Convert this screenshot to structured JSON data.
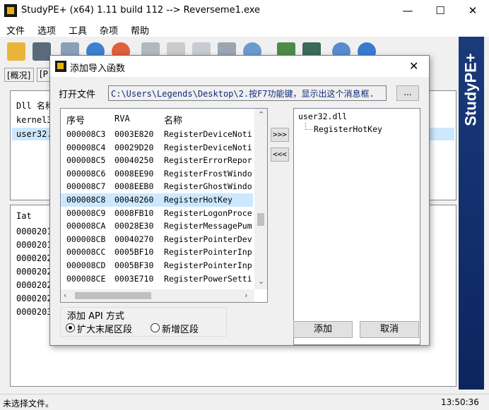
{
  "window": {
    "title": "StudyPE+ (x64) 1.11 build 112  --> Reverseme1.exe",
    "minimize": "—",
    "maximize": "☐",
    "close": "✕"
  },
  "menu": [
    "文件",
    "选项",
    "工具",
    "杂项",
    "帮助"
  ],
  "side_banner": "StudyPE+",
  "main_tabs": [
    "[概况]",
    "[P"
  ],
  "bg_upper": {
    "header": "Dll 名称",
    "rows": [
      "kernel3",
      "user32."
    ]
  },
  "bg_lower": {
    "header": "Iat",
    "rows": [
      "0000201",
      "0000201",
      "0000202",
      "0000202",
      "0000202",
      "0000202",
      "0000203"
    ]
  },
  "statusbar": {
    "left": "未选择文件。",
    "right": "13:50:36"
  },
  "dialog": {
    "title": "添加导入函数",
    "close": "✕",
    "file_label": "打开文件",
    "file_path": "C:\\Users\\Legends\\Desktop\\2.按F7功能键，显示出这个消息框.",
    "browse": "...",
    "columns": [
      "序号",
      "RVA",
      "名称"
    ],
    "rows": [
      {
        "ord": "000008C3",
        "rva": "0003E820",
        "name": "RegisterDeviceNoti"
      },
      {
        "ord": "000008C4",
        "rva": "00029D20",
        "name": "RegisterDeviceNoti"
      },
      {
        "ord": "000008C5",
        "rva": "00040250",
        "name": "RegisterErrorRepor"
      },
      {
        "ord": "000008C6",
        "rva": "0008EE90",
        "name": "RegisterFrostWindo"
      },
      {
        "ord": "000008C7",
        "rva": "0008EEB0",
        "name": "RegisterGhostWindo"
      },
      {
        "ord": "000008C8",
        "rva": "00040260",
        "name": "RegisterHotKey"
      },
      {
        "ord": "000008C9",
        "rva": "0008FB10",
        "name": "RegisterLogonProce"
      },
      {
        "ord": "000008CA",
        "rva": "00028E30",
        "name": "RegisterMessagePum"
      },
      {
        "ord": "000008CB",
        "rva": "00040270",
        "name": "RegisterPointerDev"
      },
      {
        "ord": "000008CC",
        "rva": "0005BF10",
        "name": "RegisterPointerInp"
      },
      {
        "ord": "000008CD",
        "rva": "0005BF30",
        "name": "RegisterPointerInp"
      },
      {
        "ord": "000008CE",
        "rva": "0003E710",
        "name": "RegisterPowerSetti"
      }
    ],
    "selected_index": 5,
    "add_btn": ">>>",
    "remove_btn": "<<<",
    "tree": {
      "dll": "user32.dll",
      "functions": [
        "RegisterHotKey"
      ]
    },
    "method_title": "添加 API 方式",
    "method_options": [
      "扩大末尾区段",
      "新增区段"
    ],
    "method_selected": 0,
    "ok": "添加",
    "cancel": "取消"
  }
}
